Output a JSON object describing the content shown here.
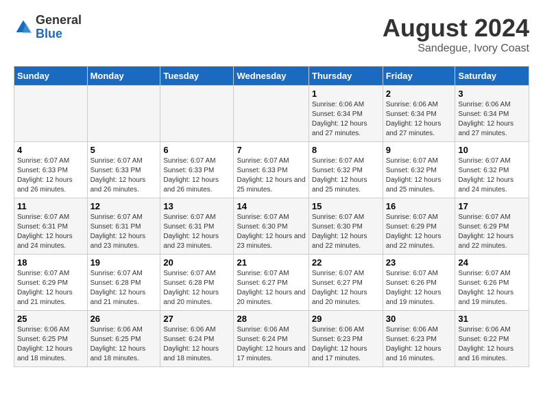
{
  "header": {
    "logo_general": "General",
    "logo_blue": "Blue",
    "main_title": "August 2024",
    "subtitle": "Sandegue, Ivory Coast"
  },
  "days_of_week": [
    "Sunday",
    "Monday",
    "Tuesday",
    "Wednesday",
    "Thursday",
    "Friday",
    "Saturday"
  ],
  "weeks": [
    [
      {
        "day": "",
        "info": ""
      },
      {
        "day": "",
        "info": ""
      },
      {
        "day": "",
        "info": ""
      },
      {
        "day": "",
        "info": ""
      },
      {
        "day": "1",
        "info": "Sunrise: 6:06 AM\nSunset: 6:34 PM\nDaylight: 12 hours\nand 27 minutes."
      },
      {
        "day": "2",
        "info": "Sunrise: 6:06 AM\nSunset: 6:34 PM\nDaylight: 12 hours\nand 27 minutes."
      },
      {
        "day": "3",
        "info": "Sunrise: 6:06 AM\nSunset: 6:34 PM\nDaylight: 12 hours\nand 27 minutes."
      }
    ],
    [
      {
        "day": "4",
        "info": "Sunrise: 6:07 AM\nSunset: 6:33 PM\nDaylight: 12 hours\nand 26 minutes."
      },
      {
        "day": "5",
        "info": "Sunrise: 6:07 AM\nSunset: 6:33 PM\nDaylight: 12 hours\nand 26 minutes."
      },
      {
        "day": "6",
        "info": "Sunrise: 6:07 AM\nSunset: 6:33 PM\nDaylight: 12 hours\nand 26 minutes."
      },
      {
        "day": "7",
        "info": "Sunrise: 6:07 AM\nSunset: 6:33 PM\nDaylight: 12 hours\nand 25 minutes."
      },
      {
        "day": "8",
        "info": "Sunrise: 6:07 AM\nSunset: 6:32 PM\nDaylight: 12 hours\nand 25 minutes."
      },
      {
        "day": "9",
        "info": "Sunrise: 6:07 AM\nSunset: 6:32 PM\nDaylight: 12 hours\nand 25 minutes."
      },
      {
        "day": "10",
        "info": "Sunrise: 6:07 AM\nSunset: 6:32 PM\nDaylight: 12 hours\nand 24 minutes."
      }
    ],
    [
      {
        "day": "11",
        "info": "Sunrise: 6:07 AM\nSunset: 6:31 PM\nDaylight: 12 hours\nand 24 minutes."
      },
      {
        "day": "12",
        "info": "Sunrise: 6:07 AM\nSunset: 6:31 PM\nDaylight: 12 hours\nand 23 minutes."
      },
      {
        "day": "13",
        "info": "Sunrise: 6:07 AM\nSunset: 6:31 PM\nDaylight: 12 hours\nand 23 minutes."
      },
      {
        "day": "14",
        "info": "Sunrise: 6:07 AM\nSunset: 6:30 PM\nDaylight: 12 hours\nand 23 minutes."
      },
      {
        "day": "15",
        "info": "Sunrise: 6:07 AM\nSunset: 6:30 PM\nDaylight: 12 hours\nand 22 minutes."
      },
      {
        "day": "16",
        "info": "Sunrise: 6:07 AM\nSunset: 6:29 PM\nDaylight: 12 hours\nand 22 minutes."
      },
      {
        "day": "17",
        "info": "Sunrise: 6:07 AM\nSunset: 6:29 PM\nDaylight: 12 hours\nand 22 minutes."
      }
    ],
    [
      {
        "day": "18",
        "info": "Sunrise: 6:07 AM\nSunset: 6:29 PM\nDaylight: 12 hours\nand 21 minutes."
      },
      {
        "day": "19",
        "info": "Sunrise: 6:07 AM\nSunset: 6:28 PM\nDaylight: 12 hours\nand 21 minutes."
      },
      {
        "day": "20",
        "info": "Sunrise: 6:07 AM\nSunset: 6:28 PM\nDaylight: 12 hours\nand 20 minutes."
      },
      {
        "day": "21",
        "info": "Sunrise: 6:07 AM\nSunset: 6:27 PM\nDaylight: 12 hours\nand 20 minutes."
      },
      {
        "day": "22",
        "info": "Sunrise: 6:07 AM\nSunset: 6:27 PM\nDaylight: 12 hours\nand 20 minutes."
      },
      {
        "day": "23",
        "info": "Sunrise: 6:07 AM\nSunset: 6:26 PM\nDaylight: 12 hours\nand 19 minutes."
      },
      {
        "day": "24",
        "info": "Sunrise: 6:07 AM\nSunset: 6:26 PM\nDaylight: 12 hours\nand 19 minutes."
      }
    ],
    [
      {
        "day": "25",
        "info": "Sunrise: 6:06 AM\nSunset: 6:25 PM\nDaylight: 12 hours\nand 18 minutes."
      },
      {
        "day": "26",
        "info": "Sunrise: 6:06 AM\nSunset: 6:25 PM\nDaylight: 12 hours\nand 18 minutes."
      },
      {
        "day": "27",
        "info": "Sunrise: 6:06 AM\nSunset: 6:24 PM\nDaylight: 12 hours\nand 18 minutes."
      },
      {
        "day": "28",
        "info": "Sunrise: 6:06 AM\nSunset: 6:24 PM\nDaylight: 12 hours\nand 17 minutes."
      },
      {
        "day": "29",
        "info": "Sunrise: 6:06 AM\nSunset: 6:23 PM\nDaylight: 12 hours\nand 17 minutes."
      },
      {
        "day": "30",
        "info": "Sunrise: 6:06 AM\nSunset: 6:23 PM\nDaylight: 12 hours\nand 16 minutes."
      },
      {
        "day": "31",
        "info": "Sunrise: 6:06 AM\nSunset: 6:22 PM\nDaylight: 12 hours\nand 16 minutes."
      }
    ]
  ]
}
